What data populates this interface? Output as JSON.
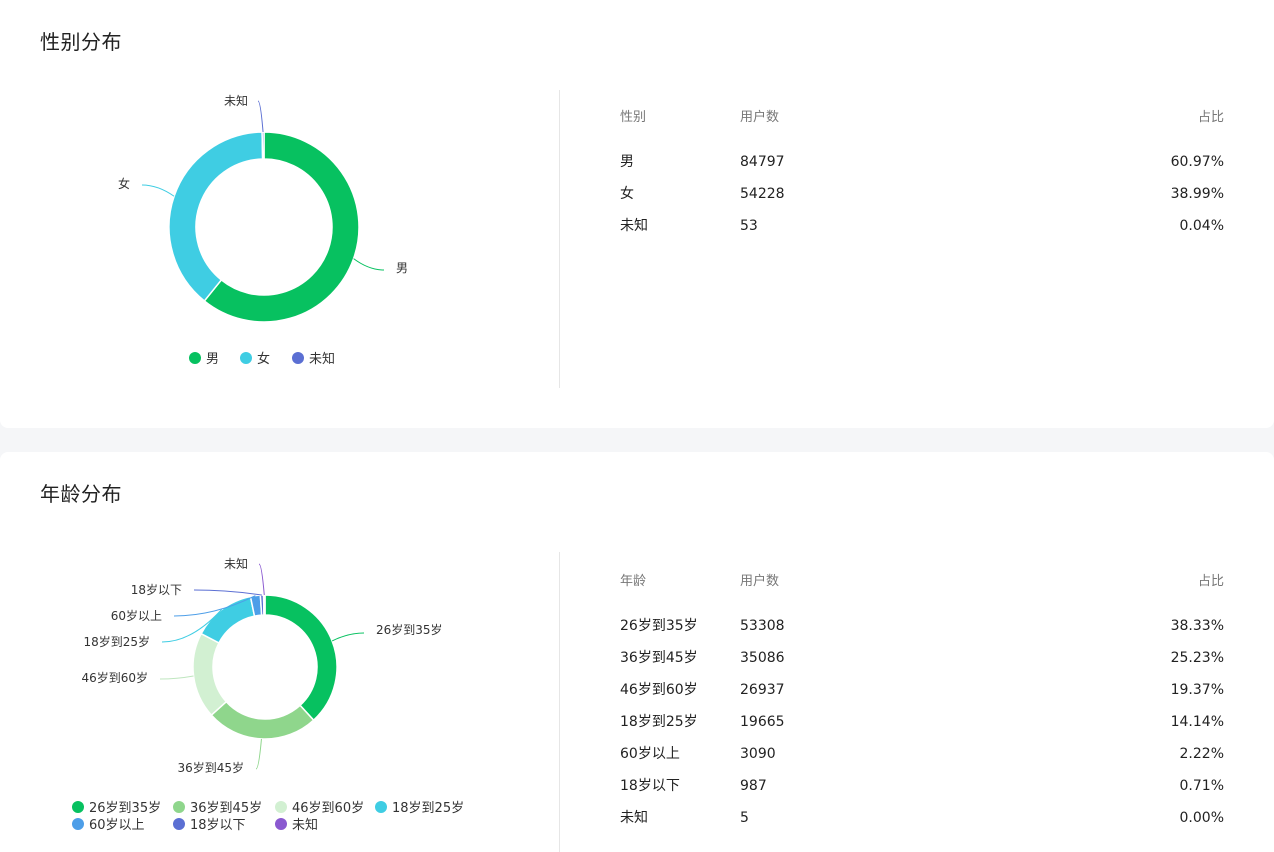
{
  "gender": {
    "title": "性别分布",
    "table": {
      "headers": [
        "性别",
        "用户数",
        "占比"
      ],
      "rows": [
        [
          "男",
          "84797",
          "60.97%"
        ],
        [
          "女",
          "54228",
          "38.99%"
        ],
        [
          "未知",
          "53",
          "0.04%"
        ]
      ]
    }
  },
  "age": {
    "title": "年龄分布",
    "table": {
      "headers": [
        "年龄",
        "用户数",
        "占比"
      ],
      "rows": [
        [
          "26岁到35岁",
          "53308",
          "38.33%"
        ],
        [
          "36岁到45岁",
          "35086",
          "25.23%"
        ],
        [
          "46岁到60岁",
          "26937",
          "19.37%"
        ],
        [
          "18岁到25岁",
          "19665",
          "14.14%"
        ],
        [
          "60岁以上",
          "3090",
          "2.22%"
        ],
        [
          "18岁以下",
          "987",
          "0.71%"
        ],
        [
          "未知",
          "5",
          "0.00%"
        ]
      ]
    }
  },
  "chart_data": [
    {
      "type": "pie",
      "variant": "donut",
      "title": "性别分布",
      "categories": [
        "男",
        "女",
        "未知"
      ],
      "values": [
        84797,
        54228,
        53
      ],
      "colors": [
        "#07c160",
        "#3fcde3",
        "#5b6fd3"
      ],
      "legend": "bottom"
    },
    {
      "type": "pie",
      "variant": "donut",
      "title": "年龄分布",
      "categories": [
        "26岁到35岁",
        "36岁到45岁",
        "46岁到60岁",
        "18岁到25岁",
        "60岁以上",
        "18岁以下",
        "未知"
      ],
      "values": [
        53308,
        35086,
        26937,
        19665,
        3090,
        987,
        5
      ],
      "colors": [
        "#07c160",
        "#8fd68c",
        "#d2f0d2",
        "#3fcde3",
        "#4d9ee8",
        "#5b6fd3",
        "#8a59d0"
      ],
      "legend": "bottom"
    }
  ]
}
